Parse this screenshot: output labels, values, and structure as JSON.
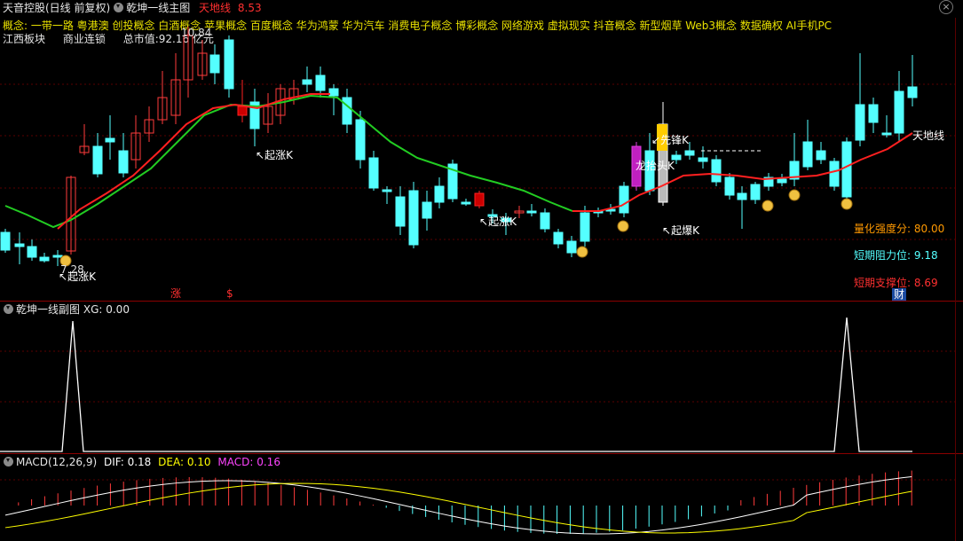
{
  "header": {
    "stock_name": "天音控股(日线 前复权)",
    "indicator_name": "乾坤一线主图",
    "line_label": "天地线",
    "line_value": "8.53",
    "close_icon": "close-icon"
  },
  "concepts": "概念: 一带一路 粤港澳 创投概念 白酒概念 苹果概念 百度概念 华为鸿蒙 华为汽车 消费电子概念 博彩概念 网络游戏 虚拟现实 抖音概念 新型烟草 Web3概念 数据确权 AI手机PC",
  "info": {
    "sector": "江西板块",
    "industry": "商业连锁",
    "market_cap": "总市值:92.16 亿元"
  },
  "chart_labels": {
    "peak": "10.84",
    "low": "7.28",
    "qizhang": "起涨K",
    "qibao": "起爆K",
    "longtou": "龙抬头K",
    "xianfeng": "先锋K",
    "tiandi": "天地线",
    "zhang": "涨",
    "dollar": "$",
    "cai": "财"
  },
  "right_stats": {
    "strength_label": "量化强度分:",
    "strength_value": "80.00",
    "resist_label": "短期阻力位:",
    "resist_value": "9.18",
    "support_label": "短期支撑位:",
    "support_value": "8.69"
  },
  "sub_panel": {
    "title": "乾坤一线副图",
    "xg_label": "XG:",
    "xg_value": "0.00"
  },
  "macd_panel": {
    "title": "MACD(12,26,9)",
    "dif_label": "DIF:",
    "dif_value": "0.18",
    "dea_label": "DEA:",
    "dea_value": "0.10",
    "macd_label": "MACD:",
    "macd_value": "0.16"
  },
  "colors": {
    "up": "#ff3b3b",
    "down": "#54ffff",
    "line_up": "#ff2020",
    "line_down": "#22cc22",
    "concept": "#e8e000",
    "dif": "#ffffff",
    "dea": "#ffff00",
    "macd": "#ff44ff"
  }
}
